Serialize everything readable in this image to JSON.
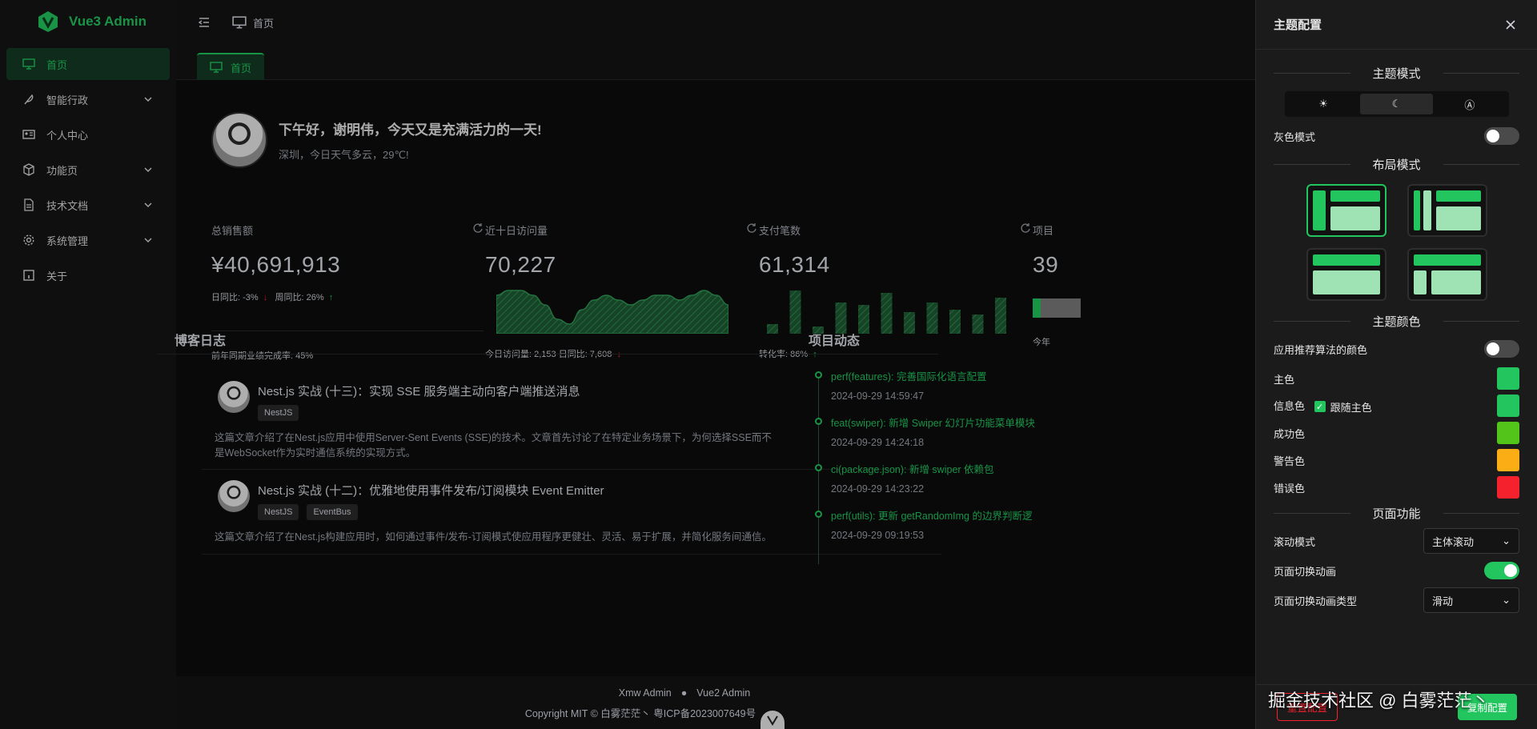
{
  "app": {
    "title": "Vue3 Admin",
    "brand_color": "#22c55e"
  },
  "sidebar": {
    "items": [
      {
        "label": "首页",
        "icon": "monitor-icon",
        "active": true,
        "has_children": false
      },
      {
        "label": "智能行政",
        "icon": "feather-icon",
        "has_children": true
      },
      {
        "label": "个人中心",
        "icon": "id-card-icon",
        "has_children": false
      },
      {
        "label": "功能页",
        "icon": "box-icon",
        "has_children": true
      },
      {
        "label": "技术文档",
        "icon": "document-icon",
        "has_children": true
      },
      {
        "label": "系统管理",
        "icon": "gear-icon",
        "has_children": true
      },
      {
        "label": "关于",
        "icon": "info-icon",
        "has_children": false
      }
    ]
  },
  "header": {
    "breadcrumb": "首页"
  },
  "tabs": [
    {
      "label": "首页",
      "active": true
    }
  ],
  "welcome": {
    "greeting": "下午好，谢明伟，今天又是充满活力的一天!",
    "weather": "深圳，今日天气多云，29℃!"
  },
  "stats": [
    {
      "title": "总销售额",
      "value": "¥40,691,913",
      "day_label": "日同比:",
      "day_value": "-3%",
      "week_label": "周同比:",
      "week_value": "26%",
      "foot": "前年同期业绩完成率: 45%"
    },
    {
      "title": "近十日访问量",
      "value": "70,227",
      "foot": "今日访问量: 2,153   日同比: 7,608"
    },
    {
      "title": "支付笔数",
      "value": "61,314",
      "foot": "转化率: 86%"
    },
    {
      "title": "项目",
      "value": "39",
      "foot": "今年"
    }
  ],
  "chart_data": [
    {
      "type": "area",
      "title": "近十日访问量",
      "x": [
        1,
        2,
        3,
        4,
        5,
        6,
        7,
        8,
        9,
        10,
        11,
        12,
        13,
        14,
        15,
        16,
        17,
        18,
        19,
        20
      ],
      "values": [
        8,
        9,
        9,
        8,
        6,
        3,
        2,
        5,
        7,
        8,
        7,
        6,
        7,
        8,
        8,
        7,
        8,
        9,
        8,
        6
      ]
    },
    {
      "type": "bar",
      "title": "支付笔数",
      "categories": [
        "1",
        "2",
        "3",
        "4",
        "5",
        "6",
        "7",
        "8",
        "9",
        "10",
        "11"
      ],
      "values": [
        2,
        9,
        1.5,
        6.5,
        6,
        8.5,
        4.5,
        6.5,
        5,
        4,
        7.5
      ]
    }
  ],
  "blog": {
    "title": "博客日志",
    "posts": [
      {
        "title": "Nest.js 实战 (十三)：实现 SSE 服务端主动向客户端推送消息",
        "tags": [
          "NestJS"
        ],
        "desc": "这篇文章介绍了在Nest.js应用中使用Server-Sent Events (SSE)的技术。文章首先讨论了在特定业务场景下，为何选择SSE而不是WebSocket作为实时通信系统的实现方式。"
      },
      {
        "title": "Nest.js 实战 (十二)：优雅地使用事件发布/订阅模块 Event Emitter",
        "tags": [
          "NestJS",
          "EventBus"
        ],
        "desc": "这篇文章介绍了在Nest.js构建应用时，如何通过事件/发布-订阅模式使应用程序更健壮、灵活、易于扩展，并简化服务间通信。"
      }
    ]
  },
  "timeline": {
    "title": "项目动态",
    "items": [
      {
        "text": "perf(features): 完善国际化语言配置",
        "time": "2024-09-29 14:59:47"
      },
      {
        "text": "feat(swiper): 新增 Swiper 幻灯片功能菜单模块",
        "time": "2024-09-29 14:24:18"
      },
      {
        "text": "ci(package.json): 新增 swiper 依赖包",
        "time": "2024-09-29 14:23:22"
      },
      {
        "text": "perf(utils): 更新 getRandomImg 的边界判断逻",
        "time": "2024-09-29 09:19:53"
      }
    ]
  },
  "footer": {
    "links": [
      "Xmw Admin",
      "Vue2 Admin"
    ],
    "copyright": "Copyright MIT © 白雾茫茫丶   粤ICP备2023007649号"
  },
  "drawer": {
    "title": "主题配置",
    "sections": {
      "theme_mode": "主题模式",
      "layout_mode": "布局模式",
      "theme_color": "主题颜色",
      "page_features": "页面功能"
    },
    "theme_modes": [
      "☀",
      "☾",
      "Ⓐ"
    ],
    "gray_mode_label": "灰色模式",
    "algo_color_label": "应用推荐算法的颜色",
    "colors": [
      {
        "label": "主色",
        "hex": "#22c55e"
      },
      {
        "label": "信息色",
        "hex": "#22c55e",
        "follow_label": "跟随主色"
      },
      {
        "label": "成功色",
        "hex": "#52c41a"
      },
      {
        "label": "警告色",
        "hex": "#faad14"
      },
      {
        "label": "错误色",
        "hex": "#f5222d"
      }
    ],
    "scroll_mode_label": "滚动模式",
    "scroll_mode_value": "主体滚动",
    "page_anim_label": "页面切换动画",
    "page_anim_type_label": "页面切换动画类型",
    "page_anim_type_value": "滑动",
    "reset_label": "重置配置",
    "copy_label": "复制配置"
  },
  "watermark": "掘金技术社区 @ 白雾茫茫丶"
}
